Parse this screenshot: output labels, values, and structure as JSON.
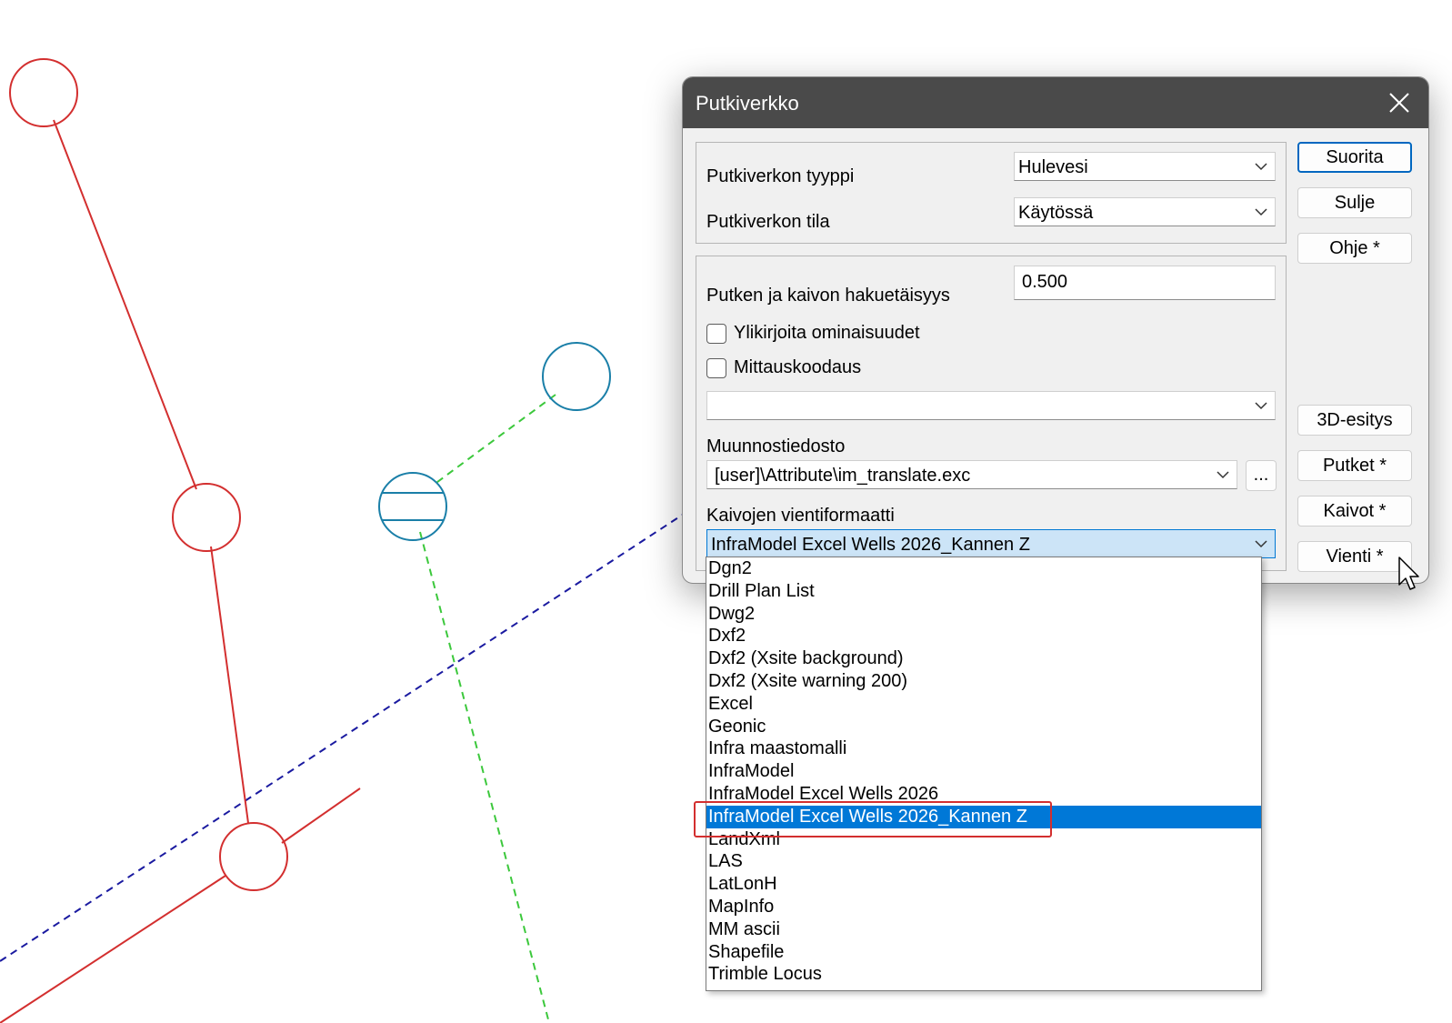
{
  "dialog": {
    "title": "Putkiverkko",
    "network_type": {
      "label": "Putkiverkon tyyppi",
      "value": "Hulevesi"
    },
    "network_state": {
      "label": "Putkiverkon tila",
      "value": "Käytössä"
    },
    "search_distance": {
      "label": "Putken ja kaivon hakuetäisyys",
      "value": "0.500"
    },
    "overwrite_properties": {
      "label": "Ylikirjoita ominaisuudet",
      "checked": false
    },
    "survey_coding": {
      "label": "Mittauskoodaus",
      "checked": false
    },
    "coding_select": {
      "value": ""
    },
    "translation_file": {
      "label": "Muunnostiedosto",
      "value": "[user]\\Attribute\\im_translate.exc",
      "browse_label": "..."
    },
    "export_format": {
      "label": "Kaivojen vientiformaatti",
      "value": "InfraModel Excel Wells 2026_Kannen Z"
    },
    "buttons": {
      "run": "Suorita",
      "close": "Sulje",
      "help": "Ohje *",
      "view_3d": "3D-esitys",
      "pipes": "Putket *",
      "wells": "Kaivot *",
      "export": "Vienti *"
    }
  },
  "dropdown": {
    "options": [
      "Dgn2",
      "Drill Plan List",
      "Dwg2",
      "Dxf2",
      "Dxf2 (Xsite background)",
      "Dxf2 (Xsite warning 200)",
      "Excel",
      "Geonic",
      "Infra maastomalli",
      "InfraModel",
      "InfraModel Excel Wells 2026",
      "InfraModel Excel Wells 2026_Kannen Z",
      "LandXml",
      "LAS",
      "LatLonH",
      "MapInfo",
      "MM ascii",
      "Shapefile",
      "Trimble Locus"
    ],
    "selected": "InfraModel Excel Wells 2026_Kannen Z"
  },
  "colors": {
    "sewer_red": "#d32f2f",
    "well_blue": "#1a7fa8",
    "green_dashed": "#3cc83c",
    "navy_dashed": "#1a1aa0",
    "selection": "#0078d7",
    "title_bar": "#4a4a4a"
  }
}
